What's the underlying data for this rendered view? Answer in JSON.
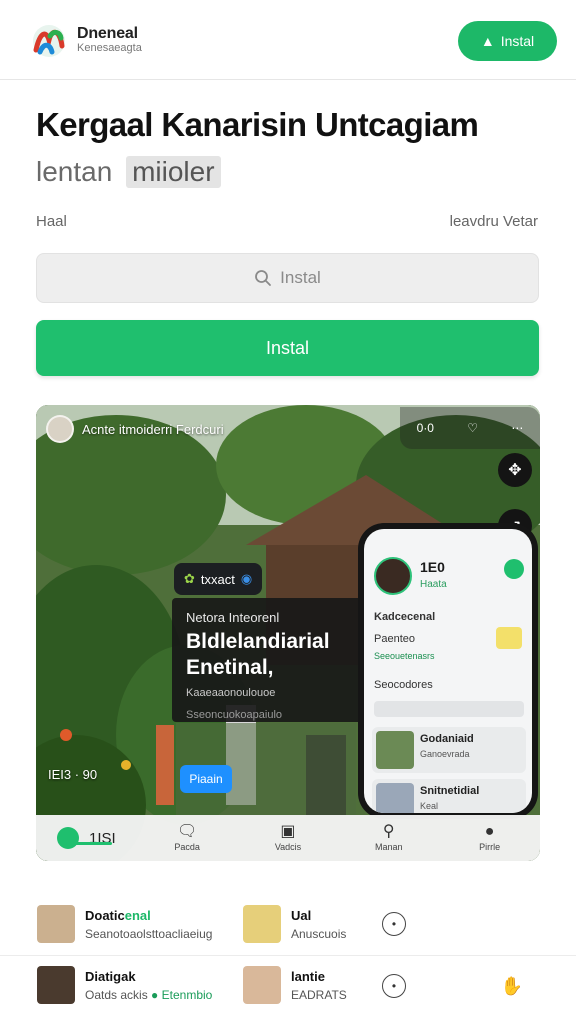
{
  "header": {
    "brand_title": "Dneneal",
    "brand_sub": "Kenesaeagta",
    "install_label": "Instal"
  },
  "hero": {
    "title": "Kergaal Kanarisin Untcagiam",
    "subtitle_plain": "lentan",
    "subtitle_chip": "miioler",
    "meta_left": "Haal",
    "meta_right": "leavdru Vetar"
  },
  "search": {
    "placeholder": "Instal"
  },
  "primary_button": {
    "label": "Instal"
  },
  "media": {
    "caption": "Acnte itmoiderri Ferdcuri",
    "tools_count": "0·0",
    "tag_chip": "txxact",
    "card_kicker": "Netora Inteorenl",
    "card_heading": "Bldlelandiarial Enetinal,",
    "card_sub": "Kaaeaaonoulouoe",
    "card_sub2": "Sseoncuokoapaiulo",
    "blue_button": "Piaain",
    "foot_left": "IEI3 · 90",
    "phone": {
      "name": "1E0",
      "name_sub": "Haata",
      "line1": "Kadcecenal",
      "line2": "Paenteo",
      "tag1": "Seeouetenasrs",
      "line3": "Seocodores",
      "row1_title": "Godaniaid",
      "row1_sub": "Ganoevrada",
      "row2_title": "Snitnetidial",
      "row2_sub": "Keal"
    }
  },
  "nav": [
    {
      "label": "1ISI",
      "icon": "home-icon"
    },
    {
      "label": "Pacda",
      "icon": "chat-icon"
    },
    {
      "label": "Vadcis",
      "icon": "inbox-icon"
    },
    {
      "label": "Manan",
      "icon": "search-icon"
    },
    {
      "label": "Pirrle",
      "icon": "profile-icon"
    }
  ],
  "list": [
    {
      "left": {
        "title_a": "Doatic",
        "title_b": "enal",
        "sub": "Seanotoaolsttoacliaeiug"
      },
      "right": {
        "title": "Ual",
        "sub": "Anuscuois"
      }
    },
    {
      "left": {
        "title_a": "Diatigak",
        "title_b": "",
        "sub": "Oatds ackis",
        "pill": "Etenmbio"
      },
      "right": {
        "title": "lantie",
        "sub": "EADRATS"
      }
    }
  ],
  "colors": {
    "accent": "#1fbf6e",
    "blue": "#1e90ff"
  }
}
